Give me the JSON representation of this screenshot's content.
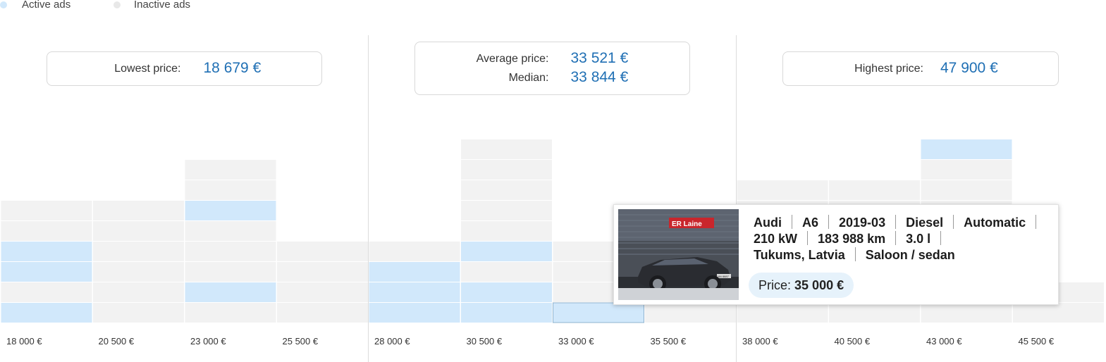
{
  "legend": {
    "active_label": "Active ads",
    "inactive_label": "Inactive ads",
    "active_color": "#d1e8fb",
    "inactive_color": "#e8e8e8"
  },
  "stats": {
    "lowest_label": "Lowest price:",
    "lowest_value": "18 679 €",
    "average_label": "Average price:",
    "average_value": "33 521 €",
    "median_label": "Median:",
    "median_value": "33 844 €",
    "highest_label": "Highest price:",
    "highest_value": "47 900 €"
  },
  "chart_data": {
    "type": "bar",
    "stacked": true,
    "categories": [
      "18 000 €",
      "20 500 €",
      "23 000 €",
      "25 500 €",
      "28 000 €",
      "30 500 €",
      "33 000 €",
      "35 500 €",
      "38 000 €",
      "40 500 €",
      "43 000 €",
      "45 500 €"
    ],
    "cells": [
      [
        "active",
        "inactive",
        "active",
        "active",
        "inactive",
        "inactive"
      ],
      [
        "inactive",
        "inactive",
        "inactive",
        "inactive",
        "inactive",
        "inactive"
      ],
      [
        "inactive",
        "active",
        "inactive",
        "inactive",
        "inactive",
        "active",
        "inactive",
        "inactive"
      ],
      [
        "inactive",
        "inactive",
        "inactive",
        "inactive"
      ],
      [
        "active",
        "active",
        "active",
        "inactive"
      ],
      [
        "active",
        "active",
        "inactive",
        "active",
        "inactive",
        "inactive",
        "inactive",
        "inactive",
        "inactive"
      ],
      [
        "active",
        "inactive",
        "inactive",
        "inactive"
      ],
      [
        "inactive",
        "inactive",
        "inactive",
        "inactive"
      ],
      [
        "inactive",
        "inactive",
        "inactive",
        "inactive",
        "inactive",
        "inactive",
        "inactive"
      ],
      [
        "inactive",
        "inactive",
        "inactive",
        "inactive",
        "inactive",
        "inactive",
        "inactive"
      ],
      [
        "inactive",
        "inactive",
        "inactive",
        "inactive",
        "inactive",
        "inactive",
        "inactive",
        "inactive",
        "active"
      ],
      [
        "inactive",
        "inactive"
      ]
    ],
    "active_counts": [
      4,
      0,
      2,
      0,
      3,
      3,
      1,
      0,
      0,
      0,
      1,
      0
    ],
    "inactive_counts": [
      2,
      6,
      6,
      4,
      1,
      6,
      3,
      4,
      7,
      7,
      8,
      2
    ],
    "highlighted": {
      "category_index": 6,
      "cell_index": 0
    },
    "colors": {
      "active": "#d1e8fb",
      "inactive": "#f2f2f2",
      "highlight": "#d1e8fb",
      "highlight_border": "#8fb3cf"
    },
    "legend": [
      "Active ads",
      "Inactive ads"
    ],
    "legend_position": "top-left"
  },
  "tooltip": {
    "line1": [
      "Audi",
      "A6",
      "2019-03",
      "Diesel",
      "Automatic"
    ],
    "line2": [
      "210 kW",
      "183 988 km",
      "3.0 l"
    ],
    "line3": [
      "Tukums, Latvia",
      "Saloon / sedan"
    ],
    "price_label": "Price:",
    "price_value": "35 000 €",
    "dealer_sign": "ER Laine",
    "plate": "NN 8887"
  }
}
